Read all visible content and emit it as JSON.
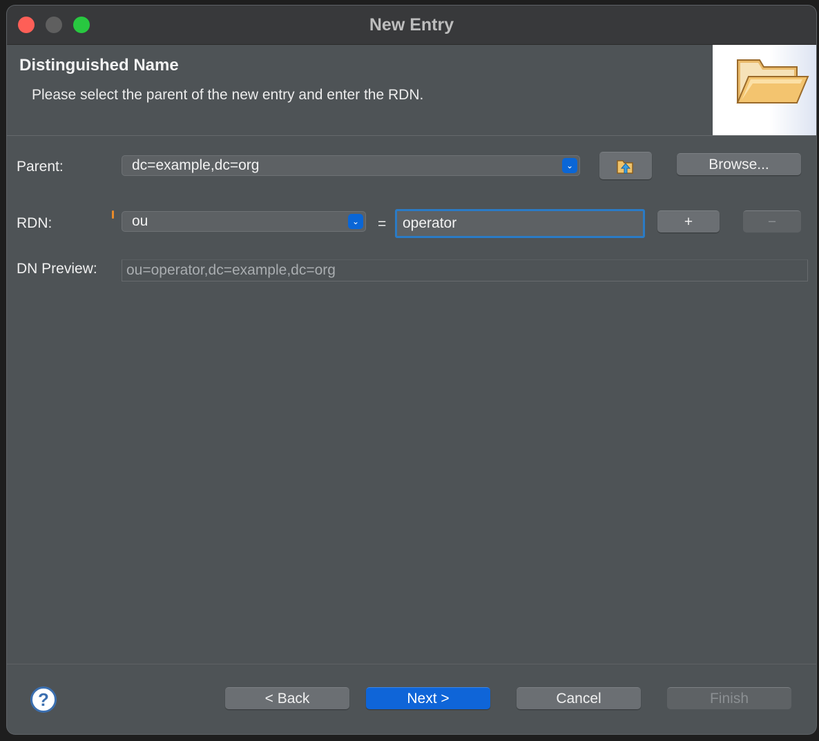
{
  "window": {
    "title": "New Entry"
  },
  "header": {
    "title": "Distinguished Name",
    "description": "Please select the parent of the new entry and enter the RDN.",
    "banner_icon": "folder-open-icon"
  },
  "form": {
    "parent": {
      "label": "Parent:",
      "value": "dc=example,dc=org",
      "up_icon": "folder-up-icon",
      "browse_label": "Browse..."
    },
    "rdn": {
      "label": "RDN:",
      "attribute": "ou",
      "equals": "=",
      "value": "operator",
      "add_label": "+",
      "remove_label": "−"
    },
    "preview": {
      "label": "DN Preview:",
      "value": "ou=operator,dc=example,dc=org"
    }
  },
  "footer": {
    "help_icon": "help-icon",
    "help_glyph": "?",
    "back_label": "< Back",
    "next_label": "Next >",
    "cancel_label": "Cancel",
    "finish_label": "Finish"
  },
  "colors": {
    "accent": "#0f65d8",
    "focus_ring": "#2a7bc6",
    "background": "#4e5356"
  }
}
